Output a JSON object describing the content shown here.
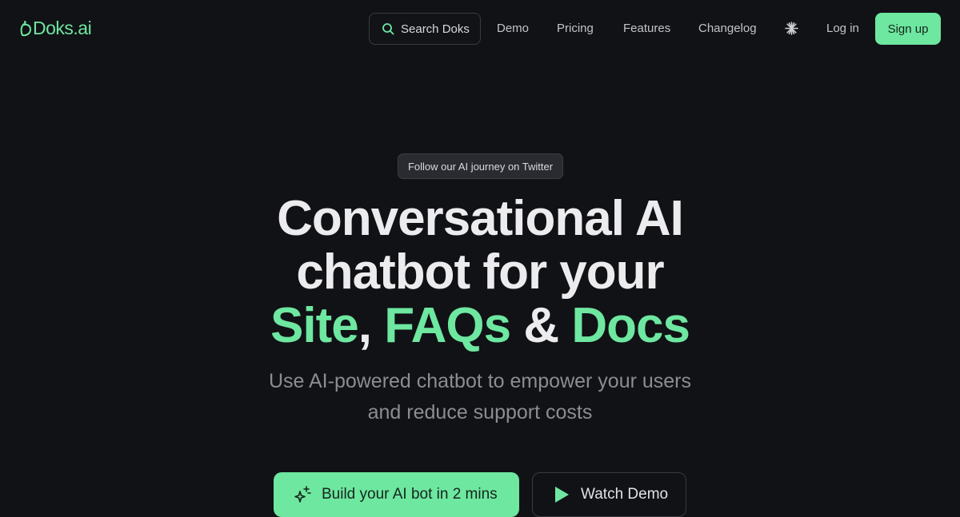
{
  "brand": {
    "name": "Doks.ai",
    "logo_icon": "doks-logo-icon",
    "accent_color": "#6ee7a0"
  },
  "nav": {
    "search": {
      "label": "Search Doks",
      "icon": "search-icon"
    },
    "links": [
      {
        "label": "Demo"
      },
      {
        "label": "Pricing"
      },
      {
        "label": "Features"
      },
      {
        "label": "Changelog"
      }
    ],
    "theme_toggle_icon": "sun-icon",
    "login_label": "Log in",
    "signup_label": "Sign up"
  },
  "hero": {
    "announcement": "Follow our AI journey on Twitter",
    "headline_line1": "Conversational AI",
    "headline_line2": "chatbot for your",
    "headline_line3": {
      "part1": "Site",
      "sep1": ",",
      "part2": "FAQs",
      "sep2": "&",
      "part3": "Docs"
    },
    "subheadline_line1": "Use AI-powered chatbot to empower your users",
    "subheadline_line2": "and reduce support costs",
    "primary_cta": {
      "label": "Build your AI bot in 2 mins",
      "icon": "sparkles-icon"
    },
    "secondary_cta": {
      "label": "Watch Demo",
      "icon": "play-icon"
    }
  }
}
